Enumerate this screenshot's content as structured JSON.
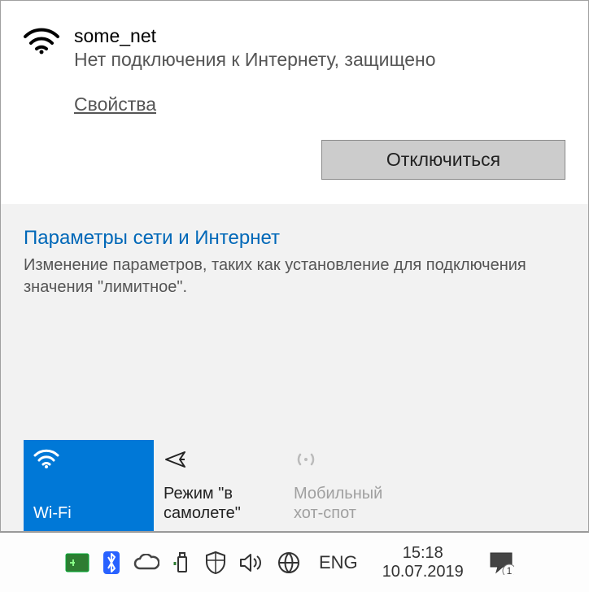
{
  "network": {
    "ssid": "some_net",
    "status": "Нет подключения к Интернету, защищено",
    "properties_link": "Свойства",
    "disconnect_label": "Отключиться"
  },
  "settings": {
    "title": "Параметры сети и Интернет",
    "description": "Изменение параметров, таких как установление для подключения значения \"лимитное\"."
  },
  "tiles": {
    "wifi": "Wi-Fi",
    "airplane": "Режим \"в самолете\"",
    "hotspot": "Мобильный хот-спот"
  },
  "tray": {
    "lang": "ENG",
    "time": "15:18",
    "date": "10.07.2019",
    "notif_count": "1"
  }
}
